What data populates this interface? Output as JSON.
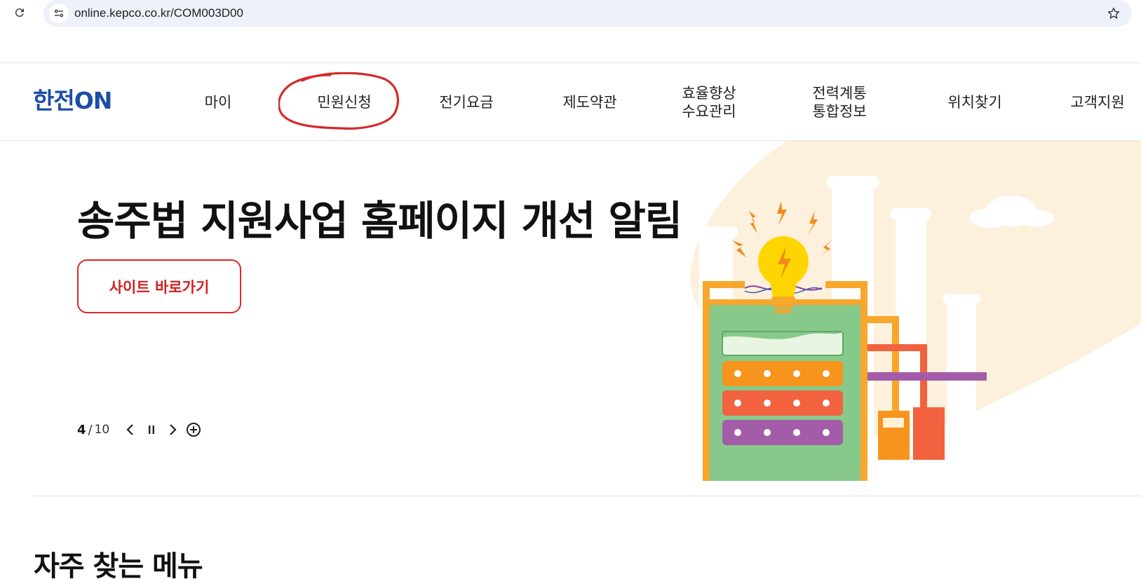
{
  "browser": {
    "url": "online.kepco.co.kr/COM003D00",
    "icons": {
      "reload": "reload-icon",
      "site_info": "tune-icon",
      "bookmark": "star-icon"
    }
  },
  "header": {
    "logo_text": "한전ON",
    "nav": [
      {
        "label": "마이"
      },
      {
        "label": "민원신청",
        "highlighted": true
      },
      {
        "label": "전기요금"
      },
      {
        "label": "제도약관"
      },
      {
        "line1": "효율향상",
        "line2": "수요관리"
      },
      {
        "line1": "전력계통",
        "line2": "통합정보"
      },
      {
        "label": "위치찾기"
      },
      {
        "label": "고객지원"
      }
    ],
    "annotation_color": "#d42a2a"
  },
  "hero": {
    "title": "송주법 지원사업 홈페이지 개선 알림",
    "button_label": "사이트 바로가기",
    "slider": {
      "current": "4",
      "separator": "/",
      "total": "10"
    },
    "accent_color": "#d62a2a"
  },
  "section": {
    "title": "자주 찾는 메뉴"
  },
  "colors": {
    "brand_blue": "#1c4ea6",
    "brand_red": "#e63b2e",
    "art_background": "#fdf0dc"
  }
}
